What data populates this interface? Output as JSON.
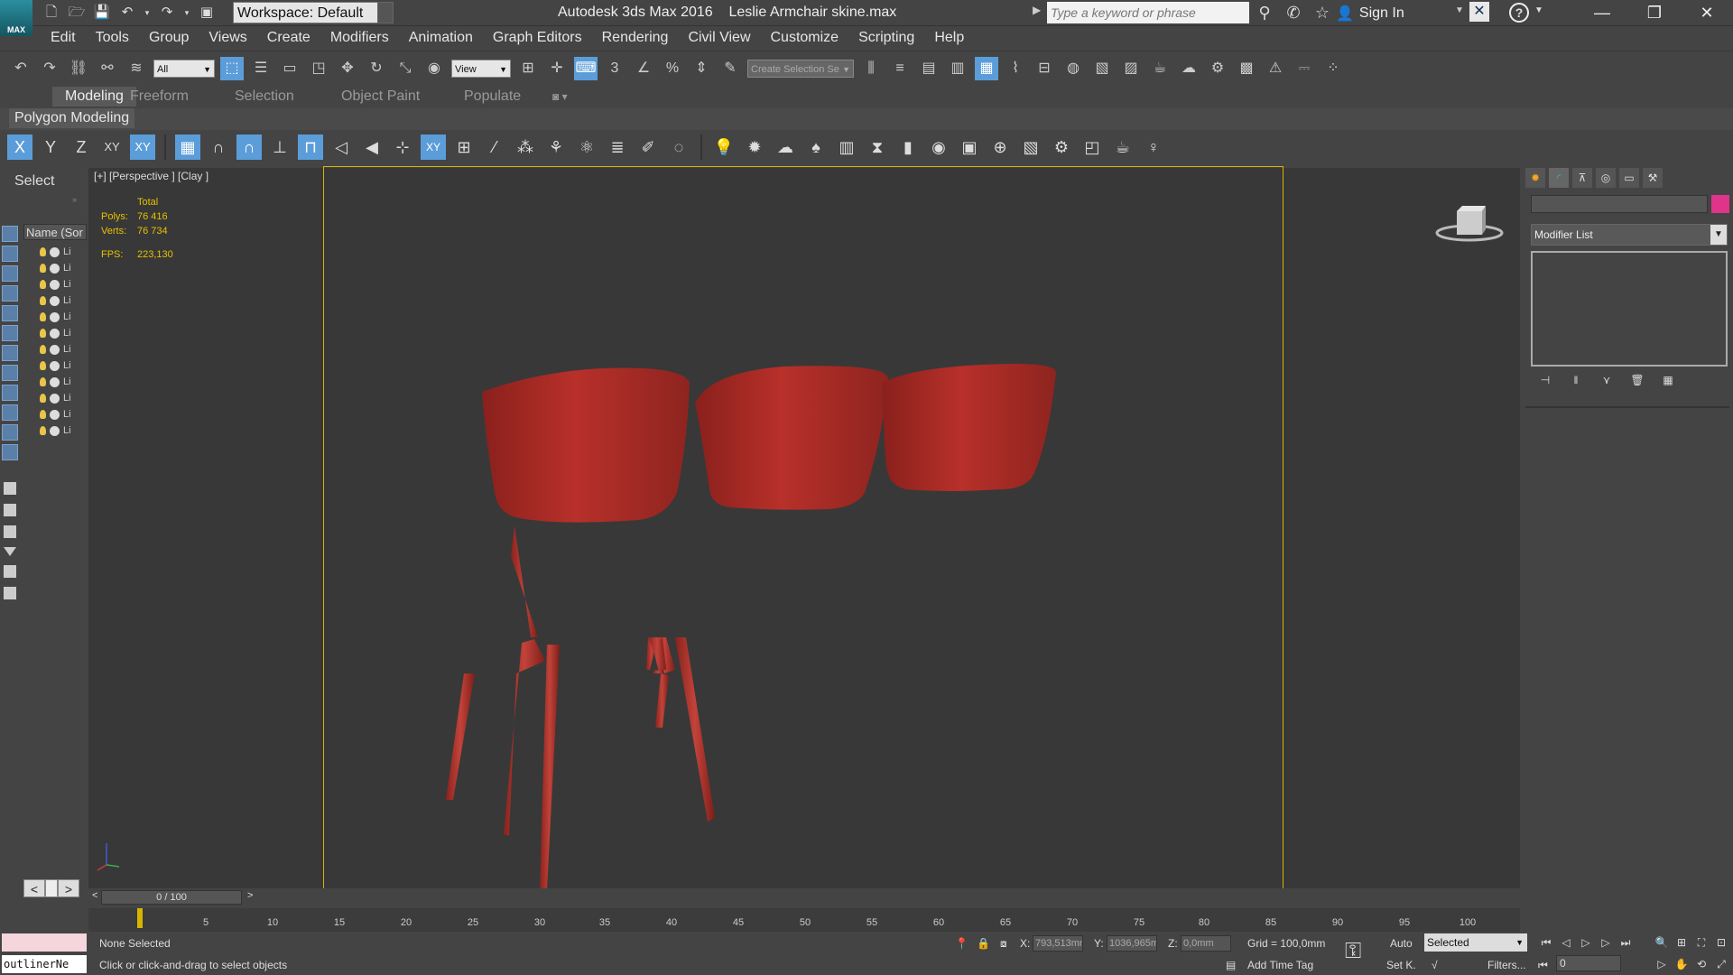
{
  "app": {
    "logo_text": "MAX",
    "title": "Autodesk 3ds Max 2016",
    "filename": "Leslie Armchair skine.max",
    "workspace": "Workspace: Default",
    "search_placeholder": "Type a keyword or phrase",
    "sign_in": "Sign In"
  },
  "menu": [
    "Edit",
    "Tools",
    "Group",
    "Views",
    "Create",
    "Modifiers",
    "Animation",
    "Graph Editors",
    "Rendering",
    "Civil View",
    "Customize",
    "Scripting",
    "Help"
  ],
  "toolbar": {
    "selection_filter": "All",
    "ref_coord": "View",
    "named_selection": "Create Selection Se"
  },
  "ribbon": {
    "tabs": [
      "Modeling",
      "Freeform",
      "Selection",
      "Object Paint",
      "Populate"
    ],
    "active_tab": "Modeling",
    "panel": "Polygon Modeling"
  },
  "axis_buttons": [
    "X",
    "Y",
    "Z",
    "XY",
    "XY"
  ],
  "scene_explorer": {
    "select_label": "Select",
    "column_header": "Name (Sor",
    "rows": [
      "Li",
      "Li",
      "Li",
      "Li",
      "Li",
      "Li",
      "Li",
      "Li",
      "Li",
      "Li",
      "Li",
      "Li"
    ]
  },
  "viewport": {
    "label": "[+] [Perspective ] [Clay ]",
    "stats": {
      "total_label": "Total",
      "polys_label": "Polys:",
      "polys": "76 416",
      "verts_label": "Verts:",
      "verts": "76 734",
      "fps_label": "FPS:",
      "fps": "223,130"
    },
    "chair_color": "#b8302a"
  },
  "command_panel": {
    "modifier_list": "Modifier List",
    "object_color": "#e0338a"
  },
  "timeline": {
    "frame_display": "0 / 100",
    "prev": "<",
    "next": ">",
    "ticks": [
      "5",
      "10",
      "15",
      "20",
      "25",
      "30",
      "35",
      "40",
      "45",
      "50",
      "55",
      "60",
      "65",
      "70",
      "75",
      "80",
      "85",
      "90",
      "95",
      "100"
    ]
  },
  "status": {
    "selection": "None Selected",
    "hint": "Click or click-and-drag to select objects",
    "outliner": "outlinerNe",
    "x_label": "X:",
    "x_value": "793,513mm",
    "y_label": "Y:",
    "y_value": "1036,965m",
    "z_label": "Z:",
    "z_value": "0,0mm",
    "grid": "Grid = 100,0mm",
    "add_time_tag": "Add Time Tag",
    "auto": "Auto",
    "set_key": "Set K.",
    "selected": "Selected",
    "filters": "Filters...",
    "current_frame": "0"
  }
}
